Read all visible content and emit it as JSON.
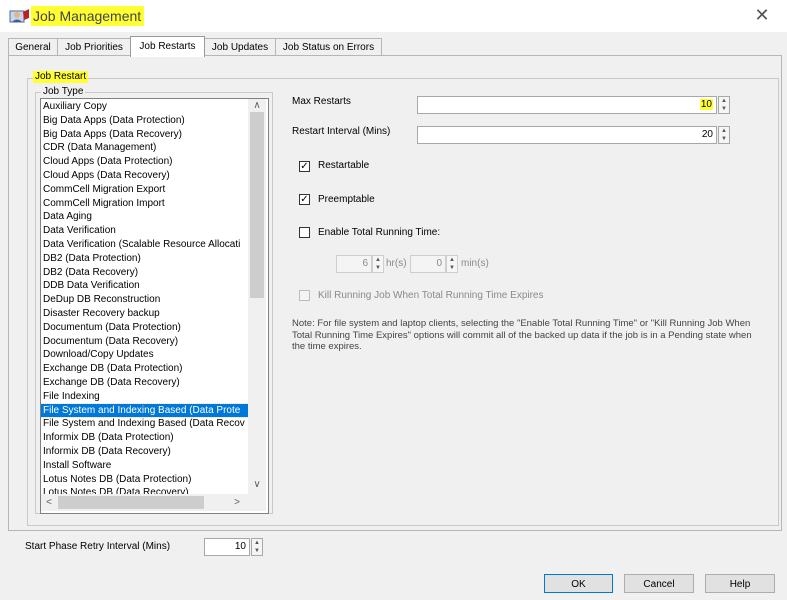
{
  "window": {
    "title": "Job Management",
    "close_glyph": "✕"
  },
  "tabs": [
    {
      "label": "General"
    },
    {
      "label": "Job Priorities"
    },
    {
      "label": "Job Restarts",
      "active": true
    },
    {
      "label": "Job Updates"
    },
    {
      "label": "Job Status on Errors"
    }
  ],
  "job_restart": {
    "group_label": "Job Restart",
    "job_type_label": "Job Type",
    "job_types": [
      "Auxiliary Copy",
      "Big Data Apps (Data Protection)",
      "Big Data Apps (Data Recovery)",
      "CDR (Data Management)",
      "Cloud Apps (Data Protection)",
      "Cloud Apps (Data Recovery)",
      "CommCell Migration Export",
      "CommCell Migration Import",
      "Data Aging",
      "Data Verification",
      "Data Verification (Scalable Resource Allocati",
      "DB2 (Data Protection)",
      "DB2 (Data Recovery)",
      "DDB Data Verification",
      "DeDup DB Reconstruction",
      "Disaster Recovery backup",
      "Documentum (Data Protection)",
      "Documentum (Data Recovery)",
      "Download/Copy Updates",
      "Exchange DB (Data Protection)",
      "Exchange DB (Data Recovery)",
      "File Indexing",
      "File System and Indexing Based (Data Prote",
      "File System and Indexing Based (Data Recov",
      "Informix DB (Data Protection)",
      "Informix DB (Data Recovery)",
      "Install Software",
      "Lotus Notes DB (Data Protection)",
      "Lotus Notes DB (Data Recovery)"
    ],
    "selected_index": 22,
    "max_restarts": {
      "label": "Max Restarts",
      "value": "10"
    },
    "restart_interval": {
      "label": "Restart Interval (Mins)",
      "value": "20"
    },
    "restartable": {
      "label": "Restartable",
      "checked": true
    },
    "preemptable": {
      "label": "Preemptable",
      "checked": true
    },
    "enable_total_running_time": {
      "label": "Enable Total Running Time:",
      "checked": false
    },
    "total_hours": {
      "value": "6",
      "unit": "hr(s)"
    },
    "total_minutes": {
      "value": "0",
      "unit": "min(s)"
    },
    "kill_running_job": {
      "label": "Kill Running Job When Total Running Time Expires",
      "checked": false
    },
    "note": "Note: For file system and laptop clients, selecting the \"Enable Total Running Time\" or \"Kill Running Job When Total Running Time Expires\" options will commit all of the backed up data if the job is in a Pending state when the time expires."
  },
  "start_phase_retry": {
    "label": "Start Phase Retry Interval (Mins)",
    "value": "10"
  },
  "footer": {
    "ok": "OK",
    "cancel": "Cancel",
    "help": "Help"
  },
  "glyphs": {
    "check": "✓",
    "up": "▲",
    "down": "▼",
    "left": "<",
    "right": ">",
    "scroll_up": "∧",
    "scroll_down": "∨"
  },
  "colors": {
    "highlight": "#ffff33",
    "selection": "#0078d7"
  }
}
